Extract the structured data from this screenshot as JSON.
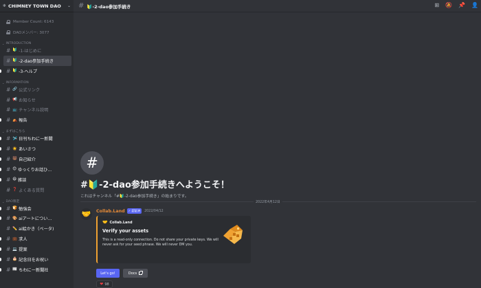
{
  "server": {
    "name": "CHIMNEY TOWN DAO",
    "icon": "snowflake-icon"
  },
  "stats": [
    {
      "label": "Member Count: 6143"
    },
    {
      "label": "DAOメンバー: 3077"
    }
  ],
  "categories": {
    "introduction": "INTRODUCTION",
    "information": "INFORMATION",
    "start": "まずはこちら",
    "dao": "DAO限定"
  },
  "channels": {
    "introduction": [
      {
        "emoji": "🔰",
        "label": "-1-はじめに"
      },
      {
        "emoji": "🔰",
        "label": "-2-dao参加手続き"
      },
      {
        "emoji": "🔰",
        "label": "-3-ヘルプ"
      }
    ],
    "information": [
      {
        "emoji": "🔗",
        "label": "公式リンク"
      },
      {
        "emoji": "📢",
        "label": "お知らせ"
      },
      {
        "emoji": "📺",
        "label": "チャンネル説明"
      },
      {
        "emoji": "⛺",
        "label": "報告"
      }
    ],
    "start": [
      {
        "emoji": "🛩️",
        "label": "日刊ちわにー新聞"
      },
      {
        "emoji": "☀️",
        "label": "あいさつ"
      },
      {
        "emoji": "🐻",
        "label": "自己紹介"
      },
      {
        "emoji": "😊",
        "label": "ゆっくりお話ひ..."
      },
      {
        "emoji": "😄",
        "label": "雑談"
      },
      {
        "emoji": "❓",
        "label": "よくある質問"
      }
    ],
    "dao": [
      {
        "emoji": "🍞",
        "label": "勉強会"
      },
      {
        "emoji": "🎨",
        "label": "aiアートについ..."
      },
      {
        "emoji": "✏️",
        "label": "ai絵かき（ベータ)"
      },
      {
        "emoji": "💼",
        "label": "求人"
      },
      {
        "emoji": "💻",
        "label": "提案"
      },
      {
        "emoji": "🎂",
        "label": "記念日をお祝い"
      },
      {
        "emoji": "📰",
        "label": "ちわにー新聞社"
      }
    ]
  },
  "header": {
    "channel_name": "🔰-2-dao参加手続き",
    "icons": [
      "threads-icon",
      "mute-bell-icon",
      "pin-icon",
      "members-icon"
    ]
  },
  "welcome": {
    "title": "#🔰-2-dao参加手続きへようこそ！",
    "subtitle": "これはチャンネル「#🔰-2-dao参加手続き」の始まりです。"
  },
  "date_divider": "2022年4月12日",
  "message": {
    "author": "Collab.Land",
    "bot_tag": "✓ 認証済",
    "timestamp": "2022/04/12",
    "embed": {
      "author_name": "Collab.Land",
      "title": "Verify your assets",
      "description": "This is a read-only connection. Do not share your private keys. We will never ask for your seed phrase. We will never DM you.",
      "accent_color": "#f0a232"
    },
    "buttons": {
      "primary": "Let's go!",
      "secondary": "Docs"
    },
    "reaction": {
      "emoji": "❤",
      "count": "98"
    }
  }
}
